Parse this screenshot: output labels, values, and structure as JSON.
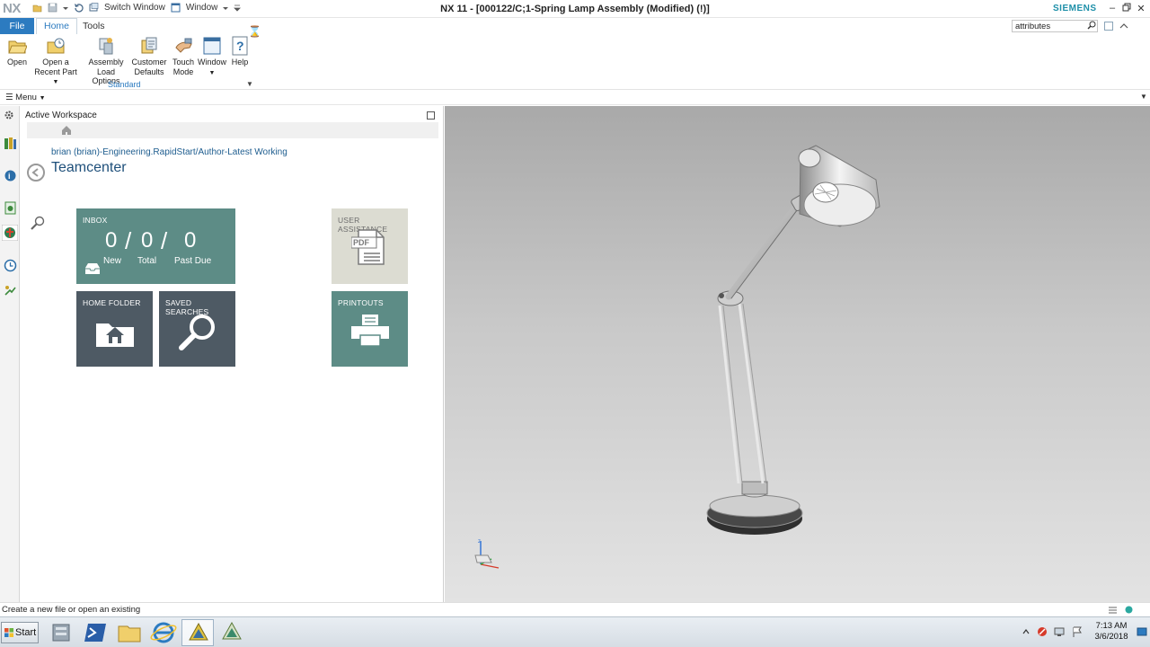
{
  "app": {
    "logo_text": "NX",
    "window_title": "NX 11 - [000122/C;1-Spring Lamp Assembly (Modified)   (!)]",
    "brand": "SIEMENS",
    "switch_window_label": "Switch Window",
    "window_menu_label": "Window"
  },
  "ribbon": {
    "tabs": {
      "file": "File",
      "home": "Home",
      "tools": "Tools"
    },
    "command_search_value": "attributes",
    "buttons": {
      "open": "Open",
      "open_recent_1": "Open a",
      "open_recent_2": "Recent Part",
      "assembly_1": "Assembly",
      "assembly_2": "Load Options",
      "customer_1": "Customer",
      "customer_2": "Defaults",
      "touch_1": "Touch",
      "touch_2": "Mode",
      "window": "Window",
      "help": "Help"
    },
    "group_label": "Standard"
  },
  "menubar": {
    "menu_label": "Menu"
  },
  "navigator": {
    "title": "Active Workspace",
    "breadcrumb_user": "brian (brian)",
    "breadcrumb_group": "-Engineering.RapidStart",
    "breadcrumb_sep": "/",
    "breadcrumb_role": "Author",
    "breadcrumb_role_suffix": "-Latest Working",
    "heading": "Teamcenter",
    "tiles": {
      "inbox": {
        "label": "INBOX",
        "new_count": "0",
        "total_count": "0",
        "pastdue_count": "0",
        "new_label": "New",
        "total_label": "Total",
        "pastdue_label": "Past Due",
        "slash": "/"
      },
      "home_folder": "HOME FOLDER",
      "saved_searches": "SAVED SEARCHES",
      "user_assistance": "USER ASSISTANCE",
      "printouts": "PRINTOUTS",
      "pdf_text": "PDF"
    }
  },
  "status": {
    "message": "Create a new file or open an existing"
  },
  "taskbar": {
    "start_label": "Start",
    "time": "7:13 AM",
    "date": "3/6/2018"
  },
  "colors": {
    "accent": "#2c7bc0",
    "brand": "#1d8fa8",
    "tile_teal": "#5d8c86",
    "tile_slate": "#4e5a64",
    "tile_light": "#dcdcd2"
  }
}
